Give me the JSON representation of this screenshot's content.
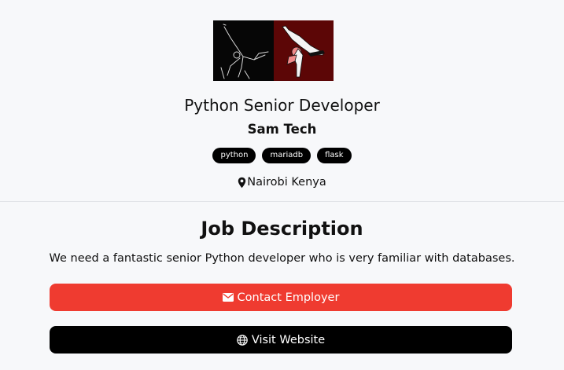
{
  "listing": {
    "title": "Python Senior Developer",
    "company": "Sam Tech",
    "tags": [
      "python",
      "mariadb",
      "flask"
    ],
    "location": "Nairobi Kenya"
  },
  "description_section": {
    "heading": "Job Description",
    "text": "We need a fantastic senior Python developer who is very familiar with databases."
  },
  "actions": {
    "contact_label": "Contact Employer",
    "website_label": "Visit Website"
  },
  "icons": {
    "location": "map-marker-icon",
    "contact": "envelope-icon",
    "website": "globe-icon"
  },
  "colors": {
    "contact_button": "#ef3b30",
    "website_button": "#000000",
    "tag_background": "#000000",
    "page_background": "#f7f8fa"
  }
}
